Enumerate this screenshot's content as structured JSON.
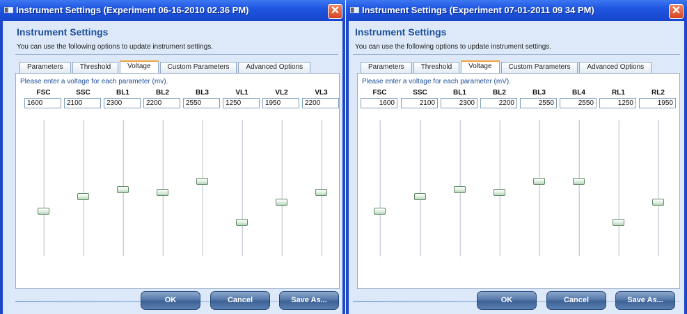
{
  "windows": [
    {
      "title": "Instrument Settings (Experiment 06-16-2010 02.36 PM)",
      "header_title": "Instrument Settings",
      "description": "You can use the following options to update instrument settings.",
      "tabs": [
        "Parameters",
        "Threshold",
        "Voltage",
        "Custom Parameters",
        "Advanced Options"
      ],
      "active_tab": "Voltage",
      "prompt": "Please enter a voltage for each parameter (mv).",
      "parameters": [
        {
          "name": "FSC",
          "value": "1600",
          "slider_level": 0.33
        },
        {
          "name": "SSC",
          "value": "2100",
          "slider_level": 0.44
        },
        {
          "name": "BL1",
          "value": "2300",
          "slider_level": 0.49
        },
        {
          "name": "BL2",
          "value": "2200",
          "slider_level": 0.47
        },
        {
          "name": "BL3",
          "value": "2550",
          "slider_level": 0.55
        },
        {
          "name": "VL1",
          "value": "1250",
          "slider_level": 0.25
        },
        {
          "name": "VL2",
          "value": "1950",
          "slider_level": 0.4
        },
        {
          "name": "VL3",
          "value": "2200",
          "slider_level": 0.47
        }
      ],
      "buttons": {
        "ok": "OK",
        "cancel": "Cancel",
        "save_as": "Save As..."
      }
    },
    {
      "title": "Instrument Settings (Experiment 07-01-2011 09 34 PM)",
      "header_title": "Instrument Settings",
      "description": "You can use the following options to update instrument settings.",
      "tabs": [
        "Parameters",
        "Threshold",
        "Voltage",
        "Custom Parameters",
        "Advanced Options"
      ],
      "active_tab": "Voltage",
      "prompt": "Please enter a voltage for each parameter (mV).",
      "parameters": [
        {
          "name": "FSC",
          "value": "1600",
          "slider_level": 0.33
        },
        {
          "name": "SSC",
          "value": "2100",
          "slider_level": 0.44
        },
        {
          "name": "BL1",
          "value": "2300",
          "slider_level": 0.49
        },
        {
          "name": "BL2",
          "value": "2200",
          "slider_level": 0.47
        },
        {
          "name": "BL3",
          "value": "2550",
          "slider_level": 0.55
        },
        {
          "name": "BL4",
          "value": "2550",
          "slider_level": 0.55
        },
        {
          "name": "RL1",
          "value": "1250",
          "slider_level": 0.25
        },
        {
          "name": "RL2",
          "value": "1950",
          "slider_level": 0.4
        }
      ],
      "buttons": {
        "ok": "OK",
        "cancel": "Cancel",
        "save_as": "Save As..."
      }
    }
  ],
  "colors": {
    "title_bar": "#1f56e0",
    "client_bg": "#dde9f8",
    "accent_tab": "#f0a33b",
    "header_text": "#1f4f99"
  }
}
